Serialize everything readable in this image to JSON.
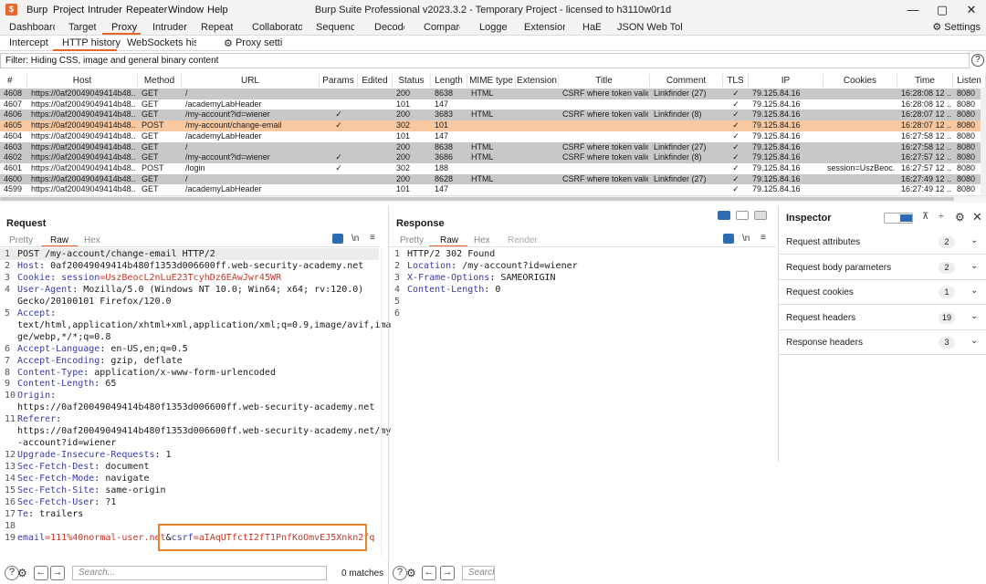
{
  "window": {
    "title": "Burp Suite Professional v2023.3.2 - Temporary Project - licensed to h3110w0r1d",
    "menu": [
      "Burp",
      "Project",
      "Intruder",
      "Repeater",
      "Window",
      "Help"
    ],
    "controls": [
      "—",
      "▢",
      "✕"
    ]
  },
  "main_tabs": [
    "Dashboard",
    "Target",
    "Proxy",
    "Intruder",
    "Repeater",
    "Collaborator",
    "Sequencer",
    "Decoder",
    "Comparer",
    "Logger",
    "Extensions",
    "HaE",
    "JSON Web Tokens"
  ],
  "active_main_tab": "Proxy",
  "settings_label": "Settings",
  "sub_tabs": [
    "Intercept",
    "HTTP history",
    "WebSockets history",
    "Proxy settings"
  ],
  "active_sub_tab": "HTTP history",
  "filter_text": "Filter: Hiding CSS, image and general binary content",
  "table": {
    "columns": [
      "#",
      "Host",
      "Method",
      "URL",
      "Params",
      "Edited",
      "Status",
      "Length",
      "MIME type",
      "Extension",
      "Title",
      "Comment",
      "TLS",
      "IP",
      "Cookies",
      "Time",
      "Listen"
    ],
    "rows": [
      {
        "num": "4608",
        "host": "https://0af20049049414b48...",
        "method": "GET",
        "url": "/",
        "params": "",
        "status": "200",
        "length": "8638",
        "mime": "HTML",
        "title": "CSRF where token valid...",
        "comment": "Linkfinder (27)",
        "tls": "✓",
        "ip": "79.125.84.16",
        "cookies": "",
        "time": "16:28:08 12 ...",
        "listen": "8080",
        "style": "gray"
      },
      {
        "num": "4607",
        "host": "https://0af20049049414b48...",
        "method": "GET",
        "url": "/academyLabHeader",
        "params": "",
        "status": "101",
        "length": "147",
        "mime": "",
        "title": "",
        "comment": "",
        "tls": "✓",
        "ip": "79.125.84.16",
        "cookies": "",
        "time": "16:28:08 12 ...",
        "listen": "8080",
        "style": "white"
      },
      {
        "num": "4606",
        "host": "https://0af20049049414b48...",
        "method": "GET",
        "url": "/my-account?id=wiener",
        "params": "✓",
        "status": "200",
        "length": "3683",
        "mime": "HTML",
        "title": "CSRF where token valid...",
        "comment": "Linkfinder (8)",
        "tls": "✓",
        "ip": "79.125.84.16",
        "cookies": "",
        "time": "16:28:07 12 ...",
        "listen": "8080",
        "style": "gray"
      },
      {
        "num": "4605",
        "host": "https://0af20049049414b48...",
        "method": "POST",
        "url": "/my-account/change-email",
        "params": "✓",
        "status": "302",
        "length": "101",
        "mime": "",
        "title": "",
        "comment": "",
        "tls": "✓",
        "ip": "79.125.84.16",
        "cookies": "",
        "time": "16:28:07 12 ...",
        "listen": "8080",
        "style": "selected"
      },
      {
        "num": "4604",
        "host": "https://0af20049049414b48...",
        "method": "GET",
        "url": "/academyLabHeader",
        "params": "",
        "status": "101",
        "length": "147",
        "mime": "",
        "title": "",
        "comment": "",
        "tls": "✓",
        "ip": "79.125.84.16",
        "cookies": "",
        "time": "16:27:58 12 ...",
        "listen": "8080",
        "style": "white"
      },
      {
        "num": "4603",
        "host": "https://0af20049049414b48...",
        "method": "GET",
        "url": "/",
        "params": "",
        "status": "200",
        "length": "8638",
        "mime": "HTML",
        "title": "CSRF where token valid...",
        "comment": "Linkfinder (27)",
        "tls": "✓",
        "ip": "79.125.84.16",
        "cookies": "",
        "time": "16:27:58 12 ...",
        "listen": "8080",
        "style": "gray"
      },
      {
        "num": "4602",
        "host": "https://0af20049049414b48...",
        "method": "GET",
        "url": "/my-account?id=wiener",
        "params": "✓",
        "status": "200",
        "length": "3686",
        "mime": "HTML",
        "title": "CSRF where token valid...",
        "comment": "Linkfinder (8)",
        "tls": "✓",
        "ip": "79.125.84.16",
        "cookies": "",
        "time": "16:27:57 12 ...",
        "listen": "8080",
        "style": "gray"
      },
      {
        "num": "4601",
        "host": "https://0af20049049414b48...",
        "method": "POST",
        "url": "/login",
        "params": "✓",
        "status": "302",
        "length": "188",
        "mime": "",
        "title": "",
        "comment": "",
        "tls": "✓",
        "ip": "79.125.84.16",
        "cookies": "session=UszBeoc...",
        "time": "16:27:57 12 ...",
        "listen": "8080",
        "style": "white"
      },
      {
        "num": "4600",
        "host": "https://0af20049049414b48...",
        "method": "GET",
        "url": "/",
        "params": "",
        "status": "200",
        "length": "8628",
        "mime": "HTML",
        "title": "CSRF where token valid...",
        "comment": "Linkfinder (27)",
        "tls": "✓",
        "ip": "79.125.84.16",
        "cookies": "",
        "time": "16:27:49 12 ...",
        "listen": "8080",
        "style": "gray"
      },
      {
        "num": "4599",
        "host": "https://0af20049049414b48...",
        "method": "GET",
        "url": "/academyLabHeader",
        "params": "",
        "status": "101",
        "length": "147",
        "mime": "",
        "title": "",
        "comment": "",
        "tls": "✓",
        "ip": "79.125.84.16",
        "cookies": "",
        "time": "16:27:49 12 ...",
        "listen": "8080",
        "style": "white"
      }
    ]
  },
  "request": {
    "title": "Request",
    "tabs": [
      "Pretty",
      "Raw",
      "Hex"
    ],
    "active_tab": "Raw",
    "lines": [
      [
        {
          "t": "POST /my-account/change-email HTTP/2",
          "c": "plain"
        }
      ],
      [
        {
          "t": "Host",
          "c": "key"
        },
        {
          "t": ": 0af20049049414b480f1353d006600ff.web-security-academy.net",
          "c": "plain"
        }
      ],
      [
        {
          "t": "Cookie",
          "c": "key"
        },
        {
          "t": ": ",
          "c": "plain"
        },
        {
          "t": "session",
          "c": "key"
        },
        {
          "t": "=UszBeocL2nLuE23TcyhDz6EAwJwr45WR",
          "c": "red"
        }
      ],
      [
        {
          "t": "User-Agent",
          "c": "key"
        },
        {
          "t": ": Mozilla/5.0 (Windows NT 10.0; Win64; x64; rv:120.0)",
          "c": "plain"
        }
      ],
      [
        {
          "t": "Gecko/20100101 Firefox/120.0",
          "c": "plain"
        }
      ],
      [
        {
          "t": "Accept",
          "c": "key"
        },
        {
          "t": ":",
          "c": "plain"
        }
      ],
      [
        {
          "t": "text/html,application/xhtml+xml,application/xml;q=0.9,image/avif,ima",
          "c": "plain"
        }
      ],
      [
        {
          "t": "ge/webp,*/*;q=0.8",
          "c": "plain"
        }
      ],
      [
        {
          "t": "Accept-Language",
          "c": "key"
        },
        {
          "t": ": en-US,en;q=0.5",
          "c": "plain"
        }
      ],
      [
        {
          "t": "Accept-Encoding",
          "c": "key"
        },
        {
          "t": ": gzip, deflate",
          "c": "plain"
        }
      ],
      [
        {
          "t": "Content-Type",
          "c": "key"
        },
        {
          "t": ": application/x-www-form-urlencoded",
          "c": "plain"
        }
      ],
      [
        {
          "t": "Content-Length",
          "c": "key"
        },
        {
          "t": ": 65",
          "c": "plain"
        }
      ],
      [
        {
          "t": "Origin",
          "c": "key"
        },
        {
          "t": ":",
          "c": "plain"
        }
      ],
      [
        {
          "t": "https://0af20049049414b480f1353d006600ff.web-security-academy.net",
          "c": "plain"
        }
      ],
      [
        {
          "t": "Referer",
          "c": "key"
        },
        {
          "t": ":",
          "c": "plain"
        }
      ],
      [
        {
          "t": "https://0af20049049414b480f1353d006600ff.web-security-academy.net/my",
          "c": "plain"
        }
      ],
      [
        {
          "t": "-account?id=wiener",
          "c": "plain"
        }
      ],
      [
        {
          "t": "Upgrade-Insecure-Requests",
          "c": "key"
        },
        {
          "t": ": 1",
          "c": "plain"
        }
      ],
      [
        {
          "t": "Sec-Fetch-Dest",
          "c": "key"
        },
        {
          "t": ": document",
          "c": "plain"
        }
      ],
      [
        {
          "t": "Sec-Fetch-Mode",
          "c": "key"
        },
        {
          "t": ": navigate",
          "c": "plain"
        }
      ],
      [
        {
          "t": "Sec-Fetch-Site",
          "c": "key"
        },
        {
          "t": ": same-origin",
          "c": "plain"
        }
      ],
      [
        {
          "t": "Sec-Fetch-User",
          "c": "key"
        },
        {
          "t": ": ?1",
          "c": "plain"
        }
      ],
      [
        {
          "t": "Te",
          "c": "key"
        },
        {
          "t": ": trailers",
          "c": "plain"
        }
      ],
      [
        {
          "t": "",
          "c": "plain"
        }
      ],
      [
        {
          "t": "email",
          "c": "key"
        },
        {
          "t": "=111%40normal-user.net",
          "c": "red"
        },
        {
          "t": "&",
          "c": "plain"
        },
        {
          "t": "csrf",
          "c": "key"
        },
        {
          "t": "=aIAqUTfctI2fT1PnfKoOmvEJ5Xnkn2fq",
          "c": "red"
        }
      ]
    ],
    "line_numbers": [
      "1",
      "2",
      "3",
      "4",
      "",
      "5",
      "",
      "",
      "6",
      "7",
      "8",
      "9",
      "10",
      "",
      "11",
      "",
      "",
      "12",
      "13",
      "14",
      "15",
      "16",
      "17",
      "18",
      "19"
    ],
    "search_placeholder": "Search...",
    "matches": "0 matches"
  },
  "response": {
    "title": "Response",
    "tabs": [
      "Pretty",
      "Raw",
      "Hex",
      "Render"
    ],
    "active_tab": "Raw",
    "lines": [
      [
        {
          "t": "HTTP/2 302 Found",
          "c": "plain"
        }
      ],
      [
        {
          "t": "Location",
          "c": "key"
        },
        {
          "t": ": /my-account?id=wiener",
          "c": "plain"
        }
      ],
      [
        {
          "t": "X-Frame-Options",
          "c": "key"
        },
        {
          "t": ": SAMEORIGIN",
          "c": "plain"
        }
      ],
      [
        {
          "t": "Content-Length",
          "c": "key"
        },
        {
          "t": ": 0",
          "c": "plain"
        }
      ],
      [
        {
          "t": "",
          "c": "plain"
        }
      ],
      [
        {
          "t": "",
          "c": "plain"
        }
      ]
    ],
    "line_numbers": [
      "1",
      "2",
      "3",
      "4",
      "5",
      "6"
    ],
    "search_placeholder": "Search..."
  },
  "inspector": {
    "title": "Inspector",
    "sections": [
      {
        "label": "Request attributes",
        "count": "2"
      },
      {
        "label": "Request body parameters",
        "count": "2"
      },
      {
        "label": "Request cookies",
        "count": "1"
      },
      {
        "label": "Request headers",
        "count": "19"
      },
      {
        "label": "Response headers",
        "count": "3"
      }
    ]
  },
  "colors": {
    "accent": "#e8672a",
    "row_gray": "#c8c8c8",
    "row_selected": "#f8c9a0",
    "highlight_box": "#e8832a"
  }
}
